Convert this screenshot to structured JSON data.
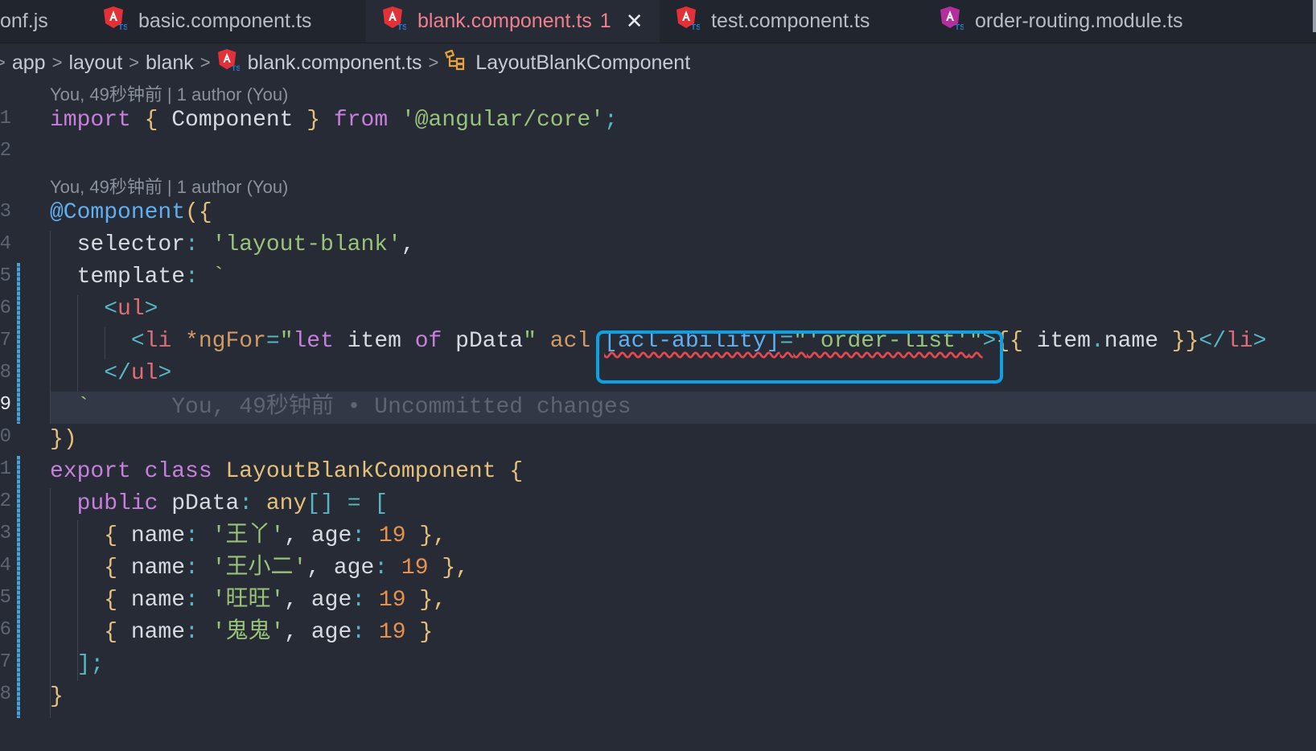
{
  "tabs": [
    {
      "label": "onf.js",
      "active": false
    },
    {
      "label": "basic.component.ts",
      "active": false
    },
    {
      "label": "blank.component.ts",
      "active": true,
      "problems": "1"
    },
    {
      "label": "test.component.ts",
      "active": false
    },
    {
      "label": "order-routing.module.ts",
      "active": false
    }
  ],
  "breadcrumb": [
    "app",
    "layout",
    "blank",
    "blank.component.ts",
    "LayoutBlankComponent"
  ],
  "codelens": {
    "line1": "You, 49秒钟前 | 1 author (You)",
    "line3": "You, 49秒钟前 | 1 author (You)"
  },
  "line_numbers": [
    "1",
    "2",
    "3",
    "4",
    "5",
    "6",
    "7",
    "8",
    "9",
    "0",
    "1",
    "2",
    "3",
    "4",
    "5",
    "6",
    "7",
    "8"
  ],
  "code": {
    "l1": {
      "k1": "import",
      "b1": "{",
      "t1": " Component ",
      "b2": "}",
      "k2": " from ",
      "s1": "'@angular/core'",
      "p1": ";"
    },
    "l3": {
      "d": "@Component",
      "p": "(",
      "b": "{"
    },
    "l4": {
      "t": "selector",
      "p": ": ",
      "s": "'layout-blank'",
      "c": ","
    },
    "l5": {
      "t": "template",
      "p": ": ",
      "s": "`"
    },
    "l6": {
      "o": "<",
      "tg": "ul",
      "c": ">"
    },
    "l7": {
      "o": "<",
      "tg": "li",
      "a1": " *ngFor",
      "eq": "=",
      "q1": "\"",
      "v1": "let",
      "v2": " item ",
      "v3": "of",
      "v4": " pData",
      "q2": "\"",
      "a2": " acl ",
      "a3": "[acl-ability]",
      "eq2": "=",
      "q3": "\"",
      "s": "'order-list'",
      "q4": "\"",
      "c": ">",
      "b1": "{{",
      "i": " item",
      "dot": ".",
      "n": "name ",
      "b2": "}}",
      "o2": "</",
      "tg2": "li",
      "c2": ">"
    },
    "l8": {
      "o": "</",
      "tg": "ul",
      "c": ">"
    },
    "l9": {
      "s": "`",
      "blame": "You, 49秒钟前 • Uncommitted changes"
    },
    "l10": {
      "b": "}",
      "p": ")"
    },
    "l11": {
      "k1": "export",
      "k2": " class ",
      "c": "LayoutBlankComponent",
      "b": " {"
    },
    "l12": {
      "k": "public",
      "v": " pData",
      "p": ": ",
      "t": "any",
      "br": "[]",
      "eq": " = ",
      "o": "["
    },
    "rows": [
      {
        "name": "'王丫'",
        "age": "19",
        "tail": " },"
      },
      {
        "name": "'王小二'",
        "age": "19",
        "tail": " },"
      },
      {
        "name": "'旺旺'",
        "age": "19",
        "tail": " },"
      },
      {
        "name": "'鬼鬼'",
        "age": "19",
        "tail": " }"
      }
    ],
    "row_keys": {
      "open": "{ ",
      "name_key": "name",
      "colon": ": ",
      "comma": ", ",
      "age_key": "age"
    },
    "l17": {
      "b": "]",
      "p": ";"
    },
    "l18": {
      "b": "}"
    }
  },
  "colors": {
    "accent_box": "#0aa2e6",
    "active_tab_text": "#ef7f8c",
    "error_squiggle": "#e5484d"
  },
  "icons": [
    "angular-ts-file-icon",
    "close-icon",
    "symbol-class-icon",
    "chevron-right-icon"
  ]
}
